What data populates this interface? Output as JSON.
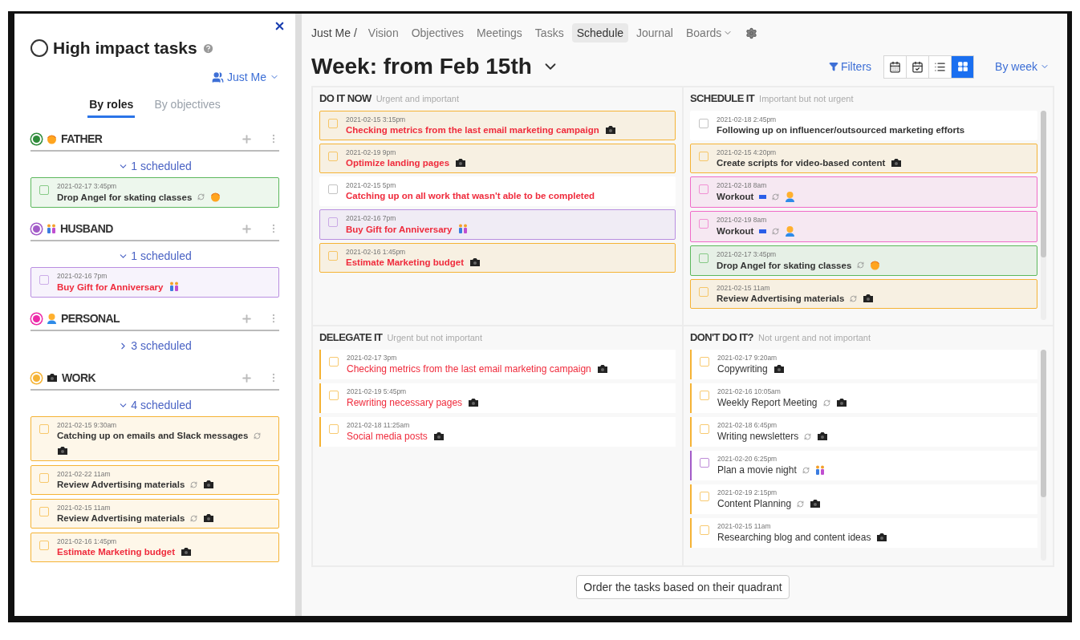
{
  "sidebar": {
    "title": "High impact tasks",
    "owner": "Just Me",
    "tabs": [
      {
        "label": "By roles",
        "selected": true
      },
      {
        "label": "By objectives",
        "selected": false
      }
    ],
    "roles": [
      {
        "name": "FATHER",
        "color": "#2e8b3a",
        "kind": "father",
        "expanded": true,
        "count": "1 scheduled",
        "tasks": [
          {
            "date": "2021-02-17 3:45pm",
            "title": "Drop Angel for skating classes",
            "color": "#5cb85c",
            "important": false,
            "recurring": true,
            "flag": false,
            "kind": "father",
            "checked": false
          }
        ]
      },
      {
        "name": "HUSBAND",
        "color": "#a25bc8",
        "kind": "husband",
        "expanded": true,
        "count": "1 scheduled",
        "tasks": [
          {
            "date": "2021-02-16 7pm",
            "title": "Buy Gift for Anniversary",
            "color": "#b98ee0",
            "important": true,
            "recurring": false,
            "flag": false,
            "kind": "husband",
            "checked": false
          }
        ]
      },
      {
        "name": "PERSONAL",
        "color": "#ec2aa8",
        "kind": "personal",
        "expanded": false,
        "count": "3 scheduled"
      },
      {
        "name": "WORK",
        "color": "#f5b335",
        "kind": "work",
        "expanded": true,
        "count": "4 scheduled",
        "tasks": [
          {
            "date": "2021-02-15 9:30am",
            "title": "Catching up on emails and Slack messages",
            "color": "#f5b335",
            "important": false,
            "recurring": true,
            "flag": false,
            "kind": "work",
            "checked": false
          },
          {
            "date": "2021-02-22 11am",
            "title": "Review Advertising materials",
            "color": "#f5b335",
            "important": false,
            "recurring": true,
            "flag": false,
            "kind": "work",
            "checked": false
          },
          {
            "date": "2021-02-15 11am",
            "title": "Review Advertising materials",
            "color": "#f5b335",
            "important": false,
            "recurring": true,
            "flag": false,
            "kind": "work",
            "checked": false
          },
          {
            "date": "2021-02-16 1:45pm",
            "title": "Estimate Marketing budget",
            "color": "#f5b335",
            "important": true,
            "recurring": false,
            "flag": false,
            "kind": "work",
            "checked": false
          }
        ]
      }
    ]
  },
  "nav": {
    "breadcrumb": "Just Me /",
    "items": [
      {
        "label": "Vision",
        "selected": false,
        "menu": false
      },
      {
        "label": "Objectives",
        "selected": false,
        "menu": false
      },
      {
        "label": "Meetings",
        "selected": false,
        "menu": false
      },
      {
        "label": "Tasks",
        "selected": false,
        "menu": false
      },
      {
        "label": "Schedule",
        "selected": true,
        "menu": false
      },
      {
        "label": "Journal",
        "selected": false,
        "menu": false
      },
      {
        "label": "Boards",
        "selected": false,
        "menu": true
      }
    ]
  },
  "heading": "Week: from Feb 15th",
  "filters": "Filters",
  "views": [
    {
      "kind": "calendar",
      "selected": false
    },
    {
      "kind": "calendar-check",
      "selected": false
    },
    {
      "kind": "list",
      "selected": false
    },
    {
      "kind": "grid",
      "selected": true
    }
  ],
  "period": "By week",
  "quadrants": [
    {
      "title": "DO IT NOW",
      "subtitle": "Urgent and important",
      "kind": "card",
      "scrollable": false,
      "tasks": [
        {
          "date": "2021-02-15 3:15pm",
          "title": "Checking metrics from the last email marketing campaign",
          "color": "#f5b335",
          "important": true,
          "recurring": false,
          "flag": false,
          "kind": "work",
          "checked": false
        },
        {
          "date": "2021-02-19 9pm",
          "title": "Optimize landing pages",
          "color": "#f5b335",
          "important": true,
          "recurring": false,
          "flag": false,
          "kind": "work",
          "checked": false
        },
        {
          "date": "2021-02-15 5pm",
          "title": "Catching up on all work that wasn't able to be completed",
          "important": true,
          "recurring": false,
          "flag": false,
          "kind": "none",
          "checked": false
        },
        {
          "date": "2021-02-16 7pm",
          "title": "Buy Gift for Anniversary",
          "color": "#b98ee0",
          "important": true,
          "recurring": false,
          "flag": false,
          "kind": "husband",
          "checked": false
        },
        {
          "date": "2021-02-16 1:45pm",
          "title": "Estimate Marketing budget",
          "color": "#f5b335",
          "important": true,
          "recurring": false,
          "flag": false,
          "kind": "work",
          "checked": false
        }
      ]
    },
    {
      "title": "SCHEDULE IT",
      "subtitle": "Important but not urgent",
      "kind": "card",
      "scrollable": true,
      "tasks": [
        {
          "date": "2021-02-18 2:45pm",
          "title": "Following up on influencer/outsourced marketing efforts",
          "important": false,
          "recurring": false,
          "flag": false,
          "kind": "none",
          "checked": false
        },
        {
          "date": "2021-02-15 4:20pm",
          "title": "Create scripts for video-based content",
          "color": "#f5b335",
          "important": false,
          "recurring": false,
          "flag": false,
          "kind": "work",
          "checked": false
        },
        {
          "date": "2021-02-18 8am",
          "title": "Workout",
          "color": "#f06bc8",
          "important": false,
          "recurring": true,
          "flag": true,
          "kind": "personal",
          "checked": false
        },
        {
          "date": "2021-02-19 8am",
          "title": "Workout",
          "color": "#f06bc8",
          "important": false,
          "recurring": true,
          "flag": true,
          "kind": "personal",
          "checked": false
        },
        {
          "date": "2021-02-17 3:45pm",
          "title": "Drop Angel for skating classes",
          "color": "#5cb85c",
          "important": false,
          "recurring": true,
          "flag": false,
          "kind": "father",
          "checked": false
        },
        {
          "date": "2021-02-15 11am",
          "title": "Review Advertising materials",
          "color": "#f5b335",
          "important": false,
          "recurring": true,
          "flag": false,
          "kind": "work",
          "checked": false
        }
      ]
    },
    {
      "title": "DELEGATE IT",
      "subtitle": "Urgent but not important",
      "kind": "strip",
      "scrollable": false,
      "tasks": [
        {
          "date": "2021-02-17 3pm",
          "title": "Checking metrics from the last email marketing campaign",
          "color": "#f5b335",
          "important": true,
          "recurring": false,
          "flag": false,
          "kind": "work",
          "checked": false
        },
        {
          "date": "2021-02-19 5:45pm",
          "title": "Rewriting necessary pages",
          "color": "#f5b335",
          "important": true,
          "recurring": false,
          "flag": false,
          "kind": "work",
          "checked": false
        },
        {
          "date": "2021-02-18 11:25am",
          "title": "Social media posts",
          "color": "#f5b335",
          "important": true,
          "recurring": false,
          "flag": false,
          "kind": "work",
          "checked": false
        }
      ]
    },
    {
      "title": "DON'T DO IT?",
      "subtitle": "Not urgent and not important",
      "kind": "strip",
      "scrollable": true,
      "tasks": [
        {
          "date": "2021-02-17 9:20am",
          "title": "Copywriting",
          "color": "#f5b335",
          "important": false,
          "recurring": false,
          "flag": false,
          "kind": "work",
          "checked": false
        },
        {
          "date": "2021-02-16 10:05am",
          "title": "Weekly Report Meeting",
          "color": "#f5b335",
          "important": false,
          "recurring": true,
          "flag": false,
          "kind": "work",
          "checked": false
        },
        {
          "date": "2021-02-18 6:45pm",
          "title": "Writing newsletters",
          "color": "#f5b335",
          "important": false,
          "recurring": true,
          "flag": false,
          "kind": "work",
          "checked": false
        },
        {
          "date": "2021-02-20 6:25pm",
          "title": "Plan a movie night",
          "color": "#a25bc8",
          "important": false,
          "recurring": true,
          "flag": false,
          "kind": "husband",
          "checked": false
        },
        {
          "date": "2021-02-19 2:15pm",
          "title": "Content Planning",
          "color": "#f5b335",
          "important": false,
          "recurring": true,
          "flag": false,
          "kind": "work",
          "checked": false
        },
        {
          "date": "2021-02-15 11am",
          "title": "Researching blog and content ideas",
          "color": "#f5b335",
          "important": false,
          "recurring": false,
          "flag": false,
          "kind": "work",
          "checked": false
        }
      ]
    }
  ],
  "order_button": "Order the tasks based on their quadrant"
}
